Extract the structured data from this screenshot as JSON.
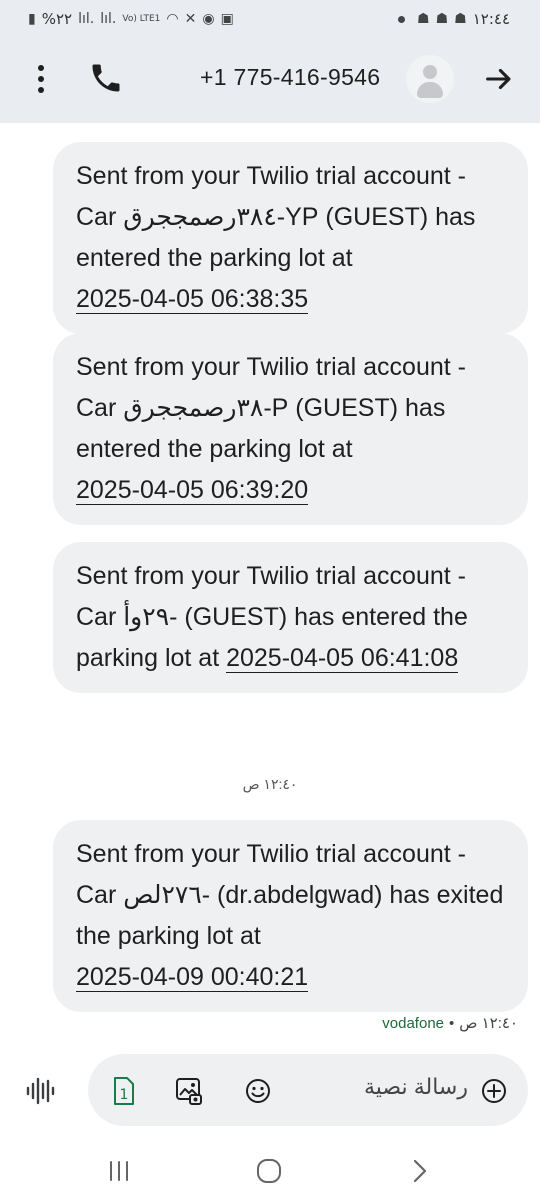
{
  "status_bar": {
    "time": "١٢:٤٤",
    "battery": "%٢٢",
    "network": "Vo) LTE1"
  },
  "header": {
    "phone_number": "+1 775-416-9546"
  },
  "messages": [
    {
      "prefix": "Sent from your Twilio trial account - Car ",
      "plate": "YP-٣٨٤رصمججرق",
      "middle": " (GUEST) has entered the parking lot at",
      "timestamp": "2025-04-05 06:38:35"
    },
    {
      "prefix": "Sent from your Twilio trial account - Car ",
      "plate": "P-٣٨رصمججرق",
      "middle": " (GUEST) has entered the parking lot at",
      "timestamp": "2025-04-05 06:39:20"
    },
    {
      "prefix": "Sent from your Twilio trial account - Car ",
      "plate": "-٢٩وأ",
      "middle": " (GUEST) has entered the parking lot at ",
      "timestamp": "2025-04-05 06:41:08"
    },
    {
      "prefix": "Sent from your Twilio trial account - Car ",
      "plate": "-٢٧٦لص",
      "middle": " (dr.abdelgwad) has exited the parking lot at",
      "timestamp": "2025-04-09 00:40:21"
    }
  ],
  "time_separator": "١٢:٤٠ ص",
  "last_meta": {
    "time": "١٢:٤٠ ص",
    "carrier": "vodafone"
  },
  "compose": {
    "placeholder": "رسالة نصية",
    "sim_number": "1"
  }
}
